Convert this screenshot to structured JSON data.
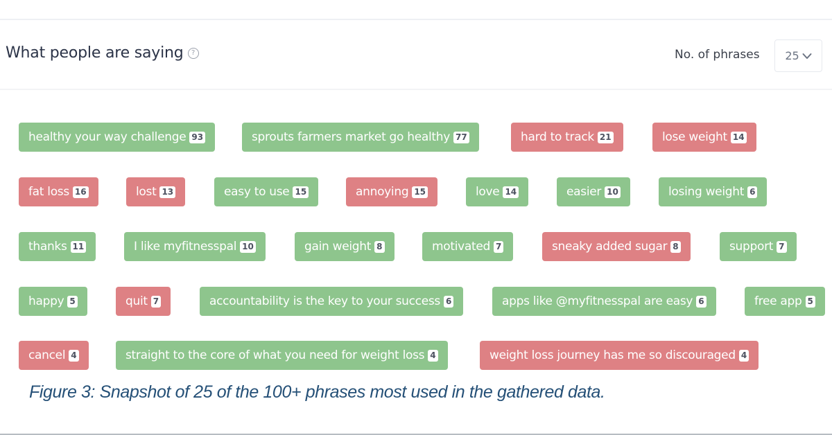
{
  "header": {
    "title": "What people are saying",
    "help_icon": "question-circle-icon",
    "phrase_count_label": "No. of phrases",
    "phrase_count_value": "25",
    "dropdown_icon": "chevron-down-icon"
  },
  "colors": {
    "positive": "#8ec58d",
    "negative": "#de8184",
    "caption": "#255077"
  },
  "phrases": [
    {
      "text": "healthy your way challenge",
      "count": "93",
      "sentiment": "positive"
    },
    {
      "text": "sprouts farmers market go healthy",
      "count": "77",
      "sentiment": "positive"
    },
    {
      "text": "hard to track",
      "count": "21",
      "sentiment": "negative"
    },
    {
      "text": "lose weight",
      "count": "14",
      "sentiment": "negative"
    },
    {
      "text": "fat loss",
      "count": "16",
      "sentiment": "negative"
    },
    {
      "text": "lost",
      "count": "13",
      "sentiment": "negative"
    },
    {
      "text": "easy to use",
      "count": "15",
      "sentiment": "positive"
    },
    {
      "text": "annoying",
      "count": "15",
      "sentiment": "negative"
    },
    {
      "text": "love",
      "count": "14",
      "sentiment": "positive"
    },
    {
      "text": "easier",
      "count": "10",
      "sentiment": "positive"
    },
    {
      "text": "losing weight",
      "count": "6",
      "sentiment": "positive"
    },
    {
      "text": "thanks",
      "count": "11",
      "sentiment": "positive"
    },
    {
      "text": "I like myfitnesspal",
      "count": "10",
      "sentiment": "positive"
    },
    {
      "text": "gain weight",
      "count": "8",
      "sentiment": "positive"
    },
    {
      "text": "motivated",
      "count": "7",
      "sentiment": "positive"
    },
    {
      "text": "sneaky added sugar",
      "count": "8",
      "sentiment": "negative"
    },
    {
      "text": "support",
      "count": "7",
      "sentiment": "positive"
    },
    {
      "text": "happy",
      "count": "5",
      "sentiment": "positive"
    },
    {
      "text": "quit",
      "count": "7",
      "sentiment": "negative"
    },
    {
      "text": "accountability is the key to your success",
      "count": "6",
      "sentiment": "positive"
    },
    {
      "text": "apps like @myfitnesspal are easy",
      "count": "6",
      "sentiment": "positive"
    },
    {
      "text": "free app",
      "count": "5",
      "sentiment": "positive"
    },
    {
      "text": "cancel",
      "count": "4",
      "sentiment": "negative"
    },
    {
      "text": "straight to the core of what you need for weight loss",
      "count": "4",
      "sentiment": "positive"
    },
    {
      "text": "weight loss journey has me so discouraged",
      "count": "4",
      "sentiment": "negative"
    }
  ],
  "caption": "Figure 3: Snapshot of 25 of the 100+ phrases most used in the gathered data."
}
